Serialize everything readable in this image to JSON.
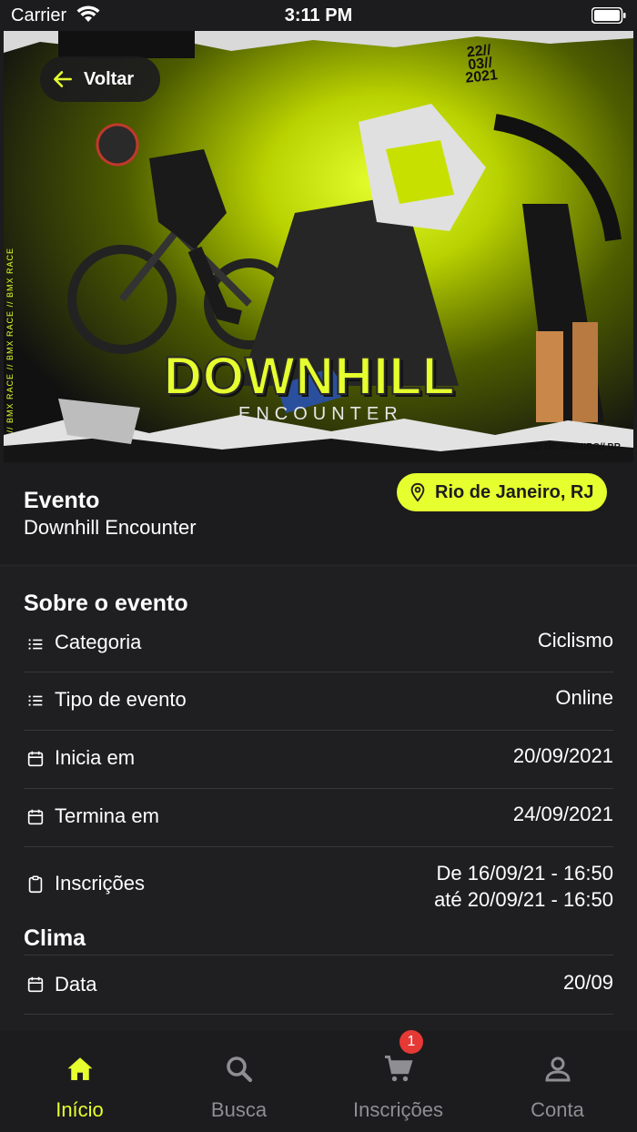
{
  "status_bar": {
    "carrier": "Carrier",
    "time": "3:11 PM"
  },
  "hero": {
    "title": "DOWNHILL",
    "subtitle": "ENCOUNTER",
    "date_line1": "22//",
    "date_line2": "03//",
    "date_line3": "2021",
    "location": "RIO DE JANEIRO// BR",
    "side_text": "BMX RACE // BMX RACE // BMX RACE // BMX RACE"
  },
  "back_button": {
    "label": "Voltar"
  },
  "event": {
    "label": "Evento",
    "name": "Downhill Encounter",
    "location": "Rio de Janeiro, RJ"
  },
  "about": {
    "title": "Sobre o evento",
    "rows": [
      {
        "label": "Categoria",
        "value": "Ciclismo",
        "icon": "list-icon"
      },
      {
        "label": "Tipo de evento",
        "value": "Online",
        "icon": "list-icon"
      },
      {
        "label": "Inicia em",
        "value": "20/09/2021",
        "icon": "calendar-icon"
      },
      {
        "label": "Termina em",
        "value": "24/09/2021",
        "icon": "calendar-icon"
      },
      {
        "label": "Inscrições",
        "value_line1": "De 16/09/21 - 16:50",
        "value_line2": "até 20/09/21 - 16:50",
        "icon": "clipboard-icon"
      }
    ]
  },
  "climate": {
    "title": "Clima",
    "rows": [
      {
        "label": "Data",
        "value": "20/09",
        "icon": "calendar-icon"
      }
    ]
  },
  "tabs": [
    {
      "label": "Início",
      "icon": "home-icon",
      "active": true
    },
    {
      "label": "Busca",
      "icon": "search-icon",
      "active": false
    },
    {
      "label": "Inscrições",
      "icon": "cart-icon",
      "active": false,
      "badge": "1"
    },
    {
      "label": "Conta",
      "icon": "person-icon",
      "active": false
    }
  ],
  "colors": {
    "accent": "#e6ff2e",
    "background": "#1c1c1e",
    "badge": "#e53935",
    "inactive": "#8e8e93"
  }
}
